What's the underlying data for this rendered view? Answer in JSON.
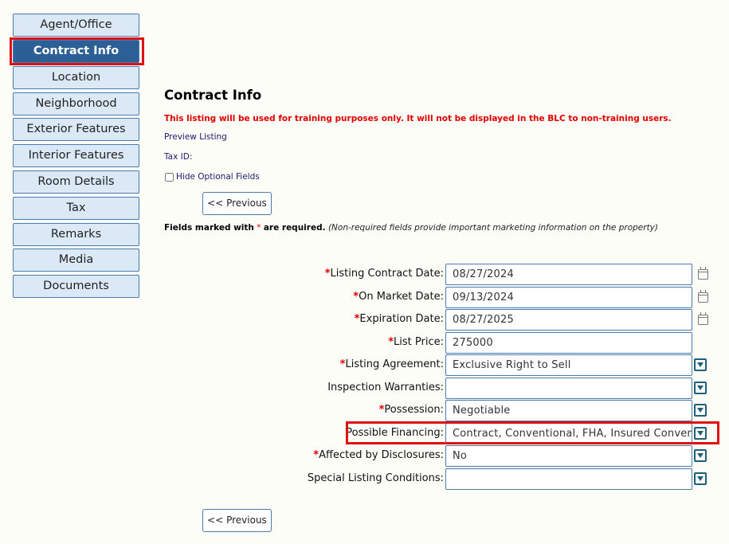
{
  "sidebar": {
    "items": [
      {
        "label": "Agent/Office"
      },
      {
        "label": "Contract Info"
      },
      {
        "label": "Location"
      },
      {
        "label": "Neighborhood"
      },
      {
        "label": "Exterior Features"
      },
      {
        "label": "Interior Features"
      },
      {
        "label": "Room Details"
      },
      {
        "label": "Tax"
      },
      {
        "label": "Remarks"
      },
      {
        "label": "Media"
      },
      {
        "label": "Documents"
      }
    ]
  },
  "main": {
    "title": "Contract Info",
    "warning": "This listing will be used for training purposes only. It will not be displayed in the BLC to non-training users.",
    "preview_link": "Preview Listing",
    "tax_id_label": "Tax ID:",
    "hide_optional_label": "Hide Optional Fields",
    "previous_label": "<< Previous",
    "required_note_prefix": "Fields marked with",
    "required_star": "*",
    "required_note_suffix": "are required.",
    "required_note_italic": "(Non-required fields provide important marketing information on the property)"
  },
  "form": {
    "fields": [
      {
        "label": "Listing Contract Date:",
        "required": true,
        "value": "08/27/2024",
        "icon": "calendar-icon"
      },
      {
        "label": "On Market Date:",
        "required": true,
        "value": "09/13/2024",
        "icon": "calendar-icon"
      },
      {
        "label": "Expiration Date:",
        "required": true,
        "value": "08/27/2025",
        "icon": "calendar-icon"
      },
      {
        "label": "List Price:",
        "required": true,
        "value": "275000",
        "icon": ""
      },
      {
        "label": "Listing Agreement:",
        "required": true,
        "value": "Exclusive Right to Sell",
        "icon": "dropdown-icon"
      },
      {
        "label": "Inspection Warranties:",
        "required": false,
        "value": "",
        "icon": "dropdown-icon"
      },
      {
        "label": "Possession:",
        "required": true,
        "value": "Negotiable",
        "icon": "dropdown-icon"
      },
      {
        "label": "Possible Financing:",
        "required": false,
        "value": "Contract, Conventional, FHA, Insured Conventic",
        "icon": "dropdown-icon"
      },
      {
        "label": "Affected by Disclosures:",
        "required": true,
        "value": "No",
        "icon": "dropdown-icon"
      },
      {
        "label": "Special Listing Conditions:",
        "required": false,
        "value": "",
        "icon": "dropdown-icon"
      }
    ]
  },
  "colors": {
    "accent": "#2c5f95",
    "highlight": "#e01010",
    "required": "#e00000"
  }
}
